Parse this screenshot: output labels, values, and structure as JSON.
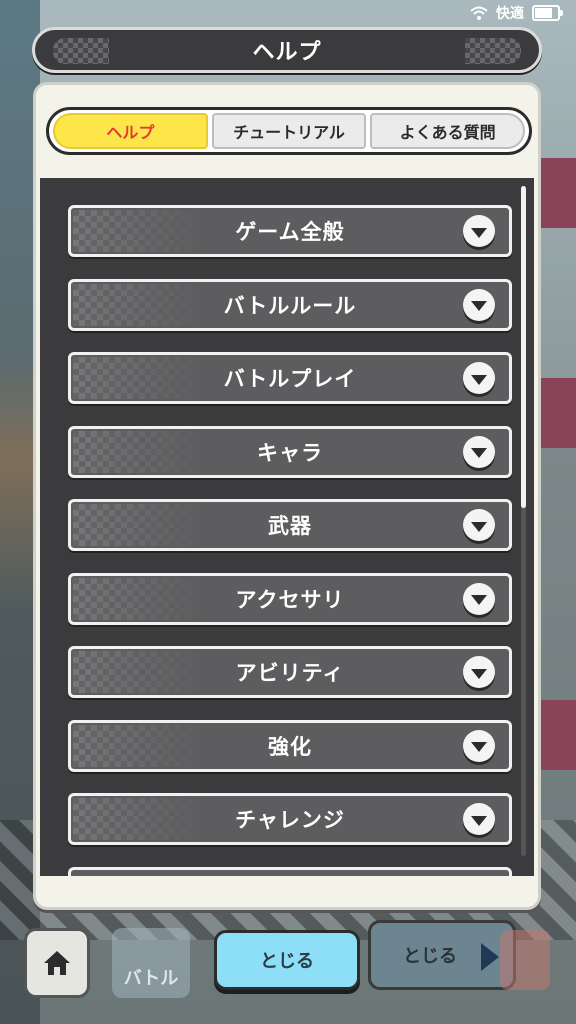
{
  "status_bar": {
    "carrier_text": "快適",
    "battery_level": 0.85
  },
  "dialog": {
    "title": "ヘルプ"
  },
  "tabs": [
    {
      "label": "ヘルプ",
      "active": true
    },
    {
      "label": "チュートリアル",
      "active": false
    },
    {
      "label": "よくある質問",
      "active": false
    }
  ],
  "help_items": [
    {
      "label": "ゲーム全般"
    },
    {
      "label": "バトルルール"
    },
    {
      "label": "バトルプレイ"
    },
    {
      "label": "キャラ"
    },
    {
      "label": "武器"
    },
    {
      "label": "アクセサリ"
    },
    {
      "label": "アビリティ"
    },
    {
      "label": "強化"
    },
    {
      "label": "チャレンジ"
    }
  ],
  "scroll": {
    "thumb_fraction": 0.48
  },
  "bottom": {
    "battle_label": "バトル",
    "close_label": "とじる",
    "close_label_ghost": "とじる"
  },
  "colors": {
    "active_tab": "#fde64a",
    "active_tab_text": "#e23c32",
    "list_bg": "#3b3b3d",
    "close_button": "#8cdff7"
  }
}
